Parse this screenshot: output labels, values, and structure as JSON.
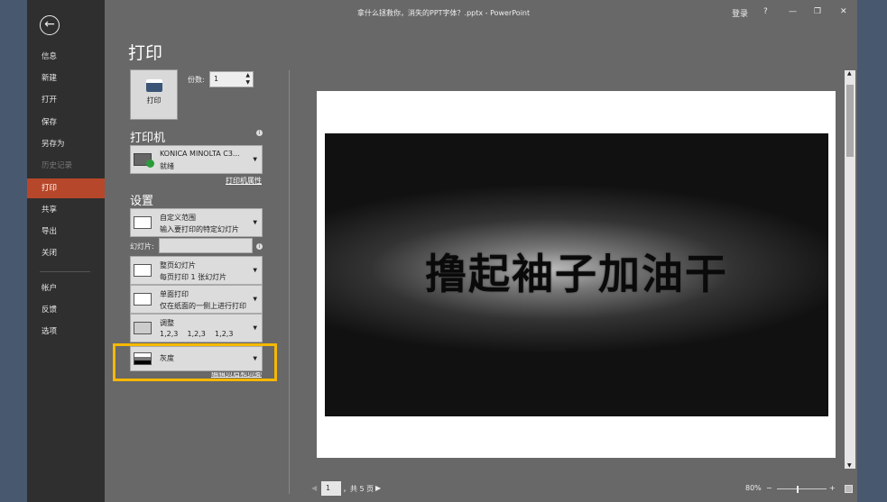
{
  "window": {
    "title": "拿什么拯救你，消失的PPT字体？.pptx  -  PowerPoint",
    "signin": "登录",
    "help": "?",
    "minimize": "—",
    "restore": "❐",
    "close": "✕"
  },
  "sidebar": {
    "back": "←",
    "items": [
      {
        "label": "信息"
      },
      {
        "label": "新建"
      },
      {
        "label": "打开"
      },
      {
        "label": "保存"
      },
      {
        "label": "另存为"
      },
      {
        "label": "历史记录"
      },
      {
        "label": "打印"
      },
      {
        "label": "共享"
      },
      {
        "label": "导出"
      },
      {
        "label": "关闭"
      },
      {
        "label": "帐户"
      },
      {
        "label": "反馈"
      },
      {
        "label": "选项"
      }
    ]
  },
  "print": {
    "heading": "打印",
    "button": "打印",
    "copies_label": "份数:",
    "copies": "1"
  },
  "printer": {
    "heading": "打印机",
    "name": "KONICA MINOLTA C3...",
    "status": "就绪",
    "properties": "打印机属性"
  },
  "settings": {
    "heading": "设置",
    "range_title": "自定义范围",
    "range_sub": "输入要打印的特定幻灯片",
    "slides_label": "幻灯片:",
    "slides_value": "",
    "layout_title": "整页幻灯片",
    "layout_sub": "每页打印 1 张幻灯片",
    "sides_title": "单面打印",
    "sides_sub": "仅在纸面的一侧上进行打印",
    "collate_title": "调整",
    "collate_sub": "1,2,3    1,2,3    1,2,3",
    "color": "灰度",
    "header_footer": "编辑页眉和页脚"
  },
  "preview": {
    "slide_text": "撸起袖子加油干",
    "page": "1",
    "total": "，共 5 页",
    "zoom": "80%"
  }
}
